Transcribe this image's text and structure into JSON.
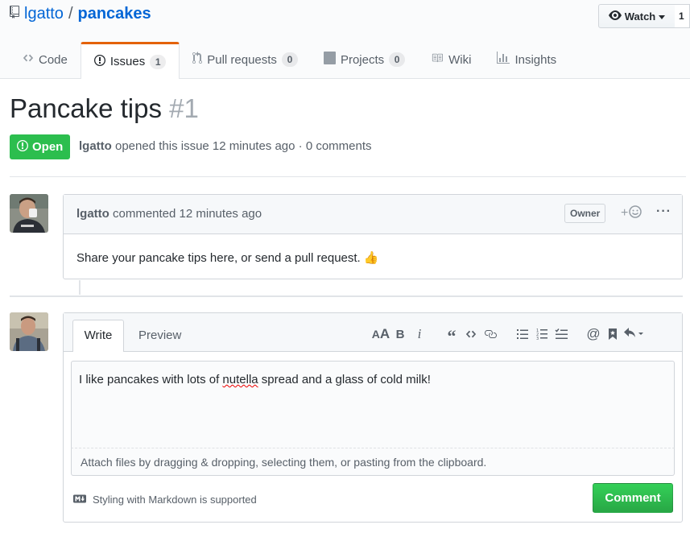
{
  "repo": {
    "owner": "lgatto",
    "separator": "/",
    "name": "pancakes",
    "watch_label": "Watch",
    "watch_count": "1"
  },
  "tabs": [
    {
      "label": "Code",
      "icon": "code-icon"
    },
    {
      "label": "Issues",
      "icon": "issue-opened-icon",
      "count": "1",
      "selected": true
    },
    {
      "label": "Pull requests",
      "icon": "git-pull-request-icon",
      "count": "0"
    },
    {
      "label": "Projects",
      "icon": "project-icon",
      "count": "0"
    },
    {
      "label": "Wiki",
      "icon": "book-icon"
    },
    {
      "label": "Insights",
      "icon": "graph-icon"
    }
  ],
  "issue": {
    "title": "Pancake tips",
    "number": "#1",
    "state": "Open",
    "author": "lgatto",
    "opened_text": "opened this issue 12 minutes ago · 0 comments"
  },
  "comment": {
    "author": "lgatto",
    "action_text": "commented 12 minutes ago",
    "owner_label": "Owner",
    "body": "Share your pancake tips here, or send a pull request. 👍"
  },
  "form": {
    "write_tab": "Write",
    "preview_tab": "Preview",
    "text_before": "I like pancakes with lots of ",
    "text_misspelled": "nutella",
    "text_after": " spread and a glass of cold milk!",
    "attach_text": "Attach files by dragging & dropping, selecting them, or pasting from the clipboard.",
    "markdown_note": "Styling with Markdown is supported",
    "submit_label": "Comment"
  },
  "colors": {
    "accent_tab": "#e36209",
    "open_green": "#2cbe4e",
    "link_blue": "#0366d6",
    "button_green": "#28a745"
  }
}
